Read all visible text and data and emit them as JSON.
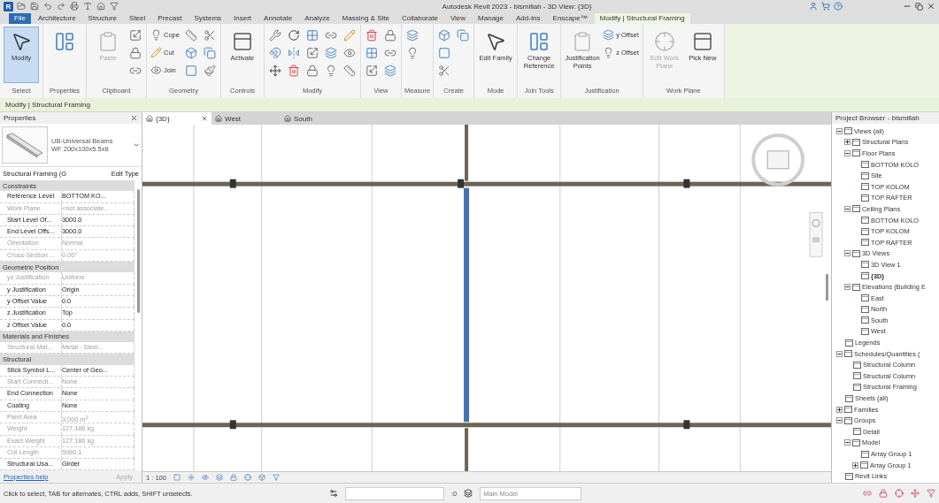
{
  "window": {
    "logo": "R",
    "title": "Autodesk Revit 2023 - bismillah - 3D View: {3D}"
  },
  "ribbon_tabs": [
    {
      "label": "File",
      "kind": "file",
      "selected": false
    },
    {
      "label": "Architecture",
      "kind": "tab",
      "selected": false
    },
    {
      "label": "Structure",
      "kind": "tab",
      "selected": false
    },
    {
      "label": "Steel",
      "kind": "tab",
      "selected": false
    },
    {
      "label": "Precast",
      "kind": "tab",
      "selected": false
    },
    {
      "label": "Systems",
      "kind": "tab",
      "selected": false
    },
    {
      "label": "Insert",
      "kind": "tab",
      "selected": false
    },
    {
      "label": "Annotate",
      "kind": "tab",
      "selected": false
    },
    {
      "label": "Analyze",
      "kind": "tab",
      "selected": false
    },
    {
      "label": "Massing & Site",
      "kind": "tab",
      "selected": false
    },
    {
      "label": "Collaborate",
      "kind": "tab",
      "selected": false
    },
    {
      "label": "View",
      "kind": "tab",
      "selected": false
    },
    {
      "label": "Manage",
      "kind": "tab",
      "selected": false
    },
    {
      "label": "Add-Ins",
      "kind": "tab",
      "selected": false
    },
    {
      "label": "Enscape™",
      "kind": "tab",
      "selected": false
    },
    {
      "label": "Modify | Structural Framing",
      "kind": "tab",
      "selected": true
    }
  ],
  "ribbon_panels": [
    {
      "label": "Select",
      "items": [
        {
          "kind": "large",
          "label": "Modify",
          "selected": true,
          "disabled": false
        }
      ]
    },
    {
      "label": "Properties",
      "items": [
        {
          "kind": "large",
          "selected": false,
          "disabled": false
        }
      ]
    },
    {
      "label": "Clipboard",
      "items": [
        {
          "kind": "large",
          "label": "Paste",
          "selected": false,
          "disabled": true
        },
        {
          "kind": "icon"
        },
        {
          "kind": "icon"
        },
        {
          "kind": "icon"
        }
      ]
    },
    {
      "label": "Geometry",
      "items": [
        {
          "kind": "small",
          "label": "Cope"
        },
        {
          "kind": "small",
          "label": "Cut"
        },
        {
          "kind": "small",
          "label": "Join"
        },
        {
          "kind": "icon"
        },
        {
          "kind": "icon"
        },
        {
          "kind": "icon"
        },
        {
          "kind": "icon"
        },
        {
          "kind": "icon"
        },
        {
          "kind": "icon"
        }
      ]
    },
    {
      "label": "Controls",
      "items": [
        {
          "kind": "large",
          "label": "Activate",
          "selected": false,
          "disabled": false
        }
      ]
    },
    {
      "label": "Modify",
      "items": [
        {
          "kind": "icon"
        },
        {
          "kind": "icon"
        },
        {
          "kind": "icon"
        },
        {
          "kind": "icon"
        },
        {
          "kind": "icon"
        },
        {
          "kind": "icon"
        },
        {
          "kind": "icon"
        },
        {
          "kind": "icon"
        },
        {
          "kind": "icon"
        },
        {
          "kind": "icon"
        },
        {
          "kind": "icon"
        },
        {
          "kind": "icon"
        },
        {
          "kind": "icon"
        },
        {
          "kind": "icon"
        },
        {
          "kind": "icon"
        }
      ]
    },
    {
      "label": "View",
      "items": [
        {
          "kind": "icon"
        },
        {
          "kind": "icon"
        },
        {
          "kind": "icon"
        },
        {
          "kind": "icon"
        },
        {
          "kind": "icon"
        },
        {
          "kind": "icon"
        }
      ]
    },
    {
      "label": "Measure",
      "items": [
        {
          "kind": "icon"
        },
        {
          "kind": "icon"
        }
      ]
    },
    {
      "label": "Create",
      "items": [
        {
          "kind": "icon"
        },
        {
          "kind": "icon"
        },
        {
          "kind": "icon"
        },
        {
          "kind": "icon"
        }
      ]
    },
    {
      "label": "Mode",
      "items": [
        {
          "kind": "large",
          "label": "Edit Family",
          "selected": false,
          "disabled": false
        }
      ]
    },
    {
      "label": "Join Tools",
      "items": [
        {
          "kind": "large",
          "label": "Change Reference",
          "selected": false,
          "disabled": false
        }
      ]
    },
    {
      "label": "Justification",
      "items": [
        {
          "kind": "large",
          "label": "Justification Points",
          "selected": false,
          "disabled": false
        },
        {
          "kind": "small",
          "label": "y Offset"
        },
        {
          "kind": "small",
          "label": "z Offset"
        }
      ]
    },
    {
      "label": "Work Plane",
      "items": [
        {
          "kind": "large",
          "label": "Edit Work Plane",
          "selected": false,
          "disabled": true
        },
        {
          "kind": "large",
          "label": "Pick New",
          "selected": false,
          "disabled": false
        }
      ]
    }
  ],
  "context_bar": "Modify | Structural Framing",
  "properties": {
    "title": "Properties",
    "type_name": "UB-Universal Beams",
    "type_size": "WF 200x100x5.5x8",
    "category": "Structural Framing (G",
    "edit_type": "Edit Type",
    "rows": [
      {
        "kind": "header",
        "label": "Constraints"
      },
      {
        "kind": "param",
        "label": "Reference Level",
        "value": "BOTTOM KO...",
        "disabled": false
      },
      {
        "kind": "param",
        "label": "Work Plane",
        "value": "<not associate...",
        "disabled": true
      },
      {
        "kind": "param",
        "label": "Start Level Of...",
        "value": "3000.0",
        "disabled": false
      },
      {
        "kind": "param",
        "label": "End Level Offs...",
        "value": "3000.0",
        "disabled": false
      },
      {
        "kind": "param",
        "label": "Orientation",
        "value": "Normal",
        "disabled": true
      },
      {
        "kind": "param",
        "label": "Cross-Section ...",
        "value": "0.00°",
        "disabled": true
      },
      {
        "kind": "header",
        "label": "Geometric Position"
      },
      {
        "kind": "param",
        "label": "yz Justification",
        "value": "Uniform",
        "disabled": true
      },
      {
        "kind": "param",
        "label": "y Justification",
        "value": "Origin",
        "disabled": false
      },
      {
        "kind": "param",
        "label": "y Offset Value",
        "value": "0.0",
        "disabled": false
      },
      {
        "kind": "param",
        "label": "z Justification",
        "value": "Top",
        "disabled": false
      },
      {
        "kind": "param",
        "label": "z Offset Value",
        "value": "0.0",
        "disabled": false
      },
      {
        "kind": "header",
        "label": "Materials and Finishes"
      },
      {
        "kind": "param",
        "label": "Structural Mat...",
        "value": "Metal - Steel...",
        "disabled": true
      },
      {
        "kind": "header",
        "label": "Structural"
      },
      {
        "kind": "param",
        "label": "Stick Symbol L...",
        "value": "Center of Geo...",
        "disabled": false
      },
      {
        "kind": "param",
        "label": "Start Connecti...",
        "value": "None",
        "disabled": true
      },
      {
        "kind": "param",
        "label": "End Connection",
        "value": "None",
        "disabled": false
      },
      {
        "kind": "param",
        "label": "Coating",
        "value": "None",
        "disabled": false
      },
      {
        "kind": "param",
        "label": "Paint Area",
        "value": "3.000 m$^{2}$",
        "disabled": true
      },
      {
        "kind": "param",
        "label": "Weight",
        "value": "127.186 kg",
        "disabled": true
      },
      {
        "kind": "param",
        "label": "Exact Weight",
        "value": "127.186 kg",
        "disabled": true
      },
      {
        "kind": "param",
        "label": "Cut Length",
        "value": "5980.1",
        "disabled": true
      },
      {
        "kind": "param",
        "label": "Structural Usa...",
        "value": "Girder",
        "disabled": false
      }
    ],
    "help_link": "Properties help",
    "apply": "Apply"
  },
  "view_tabs": [
    {
      "label": "{3D}",
      "selected": true
    },
    {
      "label": "West",
      "selected": false
    },
    {
      "label": "South",
      "selected": false
    }
  ],
  "view_bar": {
    "scale": "1 : 100"
  },
  "project_browser": {
    "title": "Project Browser - bismillah",
    "tree": [
      {
        "label": "Views (all)",
        "expanded": true,
        "children": [
          {
            "label": "Structural Plans",
            "expanded": false
          },
          {
            "label": "Floor Plans",
            "expanded": true,
            "children": [
              {
                "label": "BOTTOM KOLO"
              },
              {
                "label": "Site"
              },
              {
                "label": "TOP KOLOM"
              },
              {
                "label": "TOP RAFTER"
              }
            ]
          },
          {
            "label": "Ceiling Plans",
            "expanded": true,
            "children": [
              {
                "label": "BOTTOM KOLO"
              },
              {
                "label": "TOP KOLOM"
              },
              {
                "label": "TOP RAFTER"
              }
            ]
          },
          {
            "label": "3D Views",
            "expanded": true,
            "children": [
              {
                "label": "3D View 1",
                "current": false
              },
              {
                "label": "{3D}",
                "current": true
              }
            ]
          },
          {
            "label": "Elevations (Building E",
            "expanded": true,
            "children": [
              {
                "label": "East"
              },
              {
                "label": "North"
              },
              {
                "label": "South"
              },
              {
                "label": "West"
              }
            ]
          }
        ]
      },
      {
        "label": "Legends"
      },
      {
        "label": "Schedules/Quantities (",
        "expanded": true,
        "children": [
          {
            "label": "Structural Column"
          },
          {
            "label": "Structural Column"
          },
          {
            "label": "Structural Framing"
          }
        ]
      },
      {
        "label": "Sheets (all)"
      },
      {
        "label": "Families",
        "expanded": false
      },
      {
        "label": "Groups",
        "expanded": true,
        "children": [
          {
            "label": "Detail"
          },
          {
            "label": "Model",
            "expanded": true,
            "children": [
              {
                "label": "Array Group 1"
              },
              {
                "label": "Array Group 1",
                "expanded": false
              }
            ]
          }
        ]
      },
      {
        "label": "Revit Links"
      }
    ]
  },
  "status_bar": {
    "hint": "Click to select, TAB for alternates, CTRL adds, SHIFT unselects.",
    "counter": ":0",
    "model": "Main Model"
  }
}
